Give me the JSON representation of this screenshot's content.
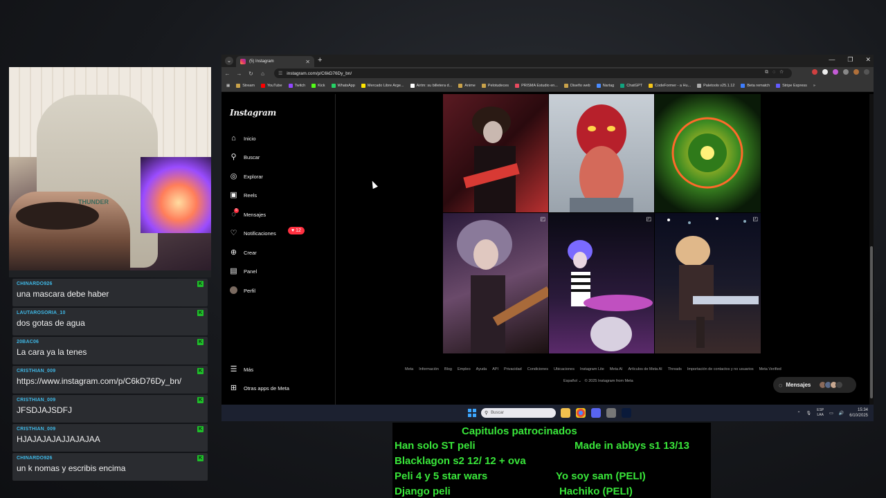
{
  "webcam": {
    "brand": "THUNDER"
  },
  "chat": {
    "messages": [
      {
        "user": "CHINARDO926",
        "text": "una mascara debe haber"
      },
      {
        "user": "LAUTAROSORIA_10",
        "text": "dos gotas de agua"
      },
      {
        "user": "20BAC06",
        "text": "La cara ya la tenes"
      },
      {
        "user": "CRISTHIAN_009",
        "text": "https://www.instagram.com/p/C6kD76Dy_bn/"
      },
      {
        "user": "CRISTHIAN_009",
        "text": "JFSDJAJSDFJ"
      },
      {
        "user": "CRISTHIAN_009",
        "text": "HJAJAJAJAJJAJAJAA"
      },
      {
        "user": "CHINARDO926",
        "text": "un k nomas y escribis encima"
      }
    ]
  },
  "browser": {
    "tab_title": "(5) Instagram",
    "url": "instagram.com/p/C6kD76Dy_bn/",
    "bookmarks": [
      "Stream",
      "YouTube",
      "Twitch",
      "Kick",
      "WhatsApp",
      "Mercado Libre Arge...",
      "Airtm: su billetera d...",
      "Anime",
      "Pelotudeces",
      "PRISMA Estudio en...",
      "Diseño web",
      "Nartag",
      "ChatGPT",
      "CodeFormer - a Hu...",
      "Paletools v25.1.12",
      "Beta rematch",
      "Stripe Express"
    ]
  },
  "instagram": {
    "logo": "Instagram",
    "nav": [
      {
        "label": "Inicio",
        "icon": "home-icon"
      },
      {
        "label": "Buscar",
        "icon": "search-icon"
      },
      {
        "label": "Explorar",
        "icon": "compass-icon"
      },
      {
        "label": "Reels",
        "icon": "reels-icon"
      },
      {
        "label": "Mensajes",
        "icon": "messenger-icon"
      },
      {
        "label": "Notificaciones",
        "icon": "heart-icon"
      },
      {
        "label": "Crear",
        "icon": "plus-icon"
      },
      {
        "label": "Panel",
        "icon": "chart-icon"
      },
      {
        "label": "Perfil",
        "icon": "avatar-icon"
      }
    ],
    "notif_badge": "12",
    "messages_badge": "5",
    "more": "Más",
    "other_apps": "Otras apps de Meta",
    "footer_links": [
      "Meta",
      "Información",
      "Blog",
      "Empleo",
      "Ayuda",
      "API",
      "Privacidad",
      "Condiciones",
      "Ubicaciones",
      "Instagram Lite",
      "Meta AI",
      "Artículos de Meta AI",
      "Threads",
      "Importación de contactos y no usuarios",
      "Meta Verified"
    ],
    "language": "Español",
    "copyright": "© 2025 Instagram from Meta",
    "messages_pill": "Mensajes"
  },
  "taskbar": {
    "search_placeholder": "Buscar",
    "lang_top": "ESP",
    "lang_bottom": "LAA",
    "time": "15:34",
    "date": "6/10/2025"
  },
  "schedule": {
    "title": "Capitulos patrocinados",
    "left": [
      "Han solo ST peli",
      "Blacklagon s2 12/ 12 + ova",
      "Peli 4  y 5 star wars",
      "Django peli"
    ],
    "right": [
      "Made in abbys s1 13/13",
      "",
      "Yo soy sam (PELI)",
      "Hachiko (PELI)"
    ]
  },
  "colors": {
    "accent": "#39e63a",
    "ig_red": "#ff3040",
    "chat_user": "#3fb8e6"
  }
}
